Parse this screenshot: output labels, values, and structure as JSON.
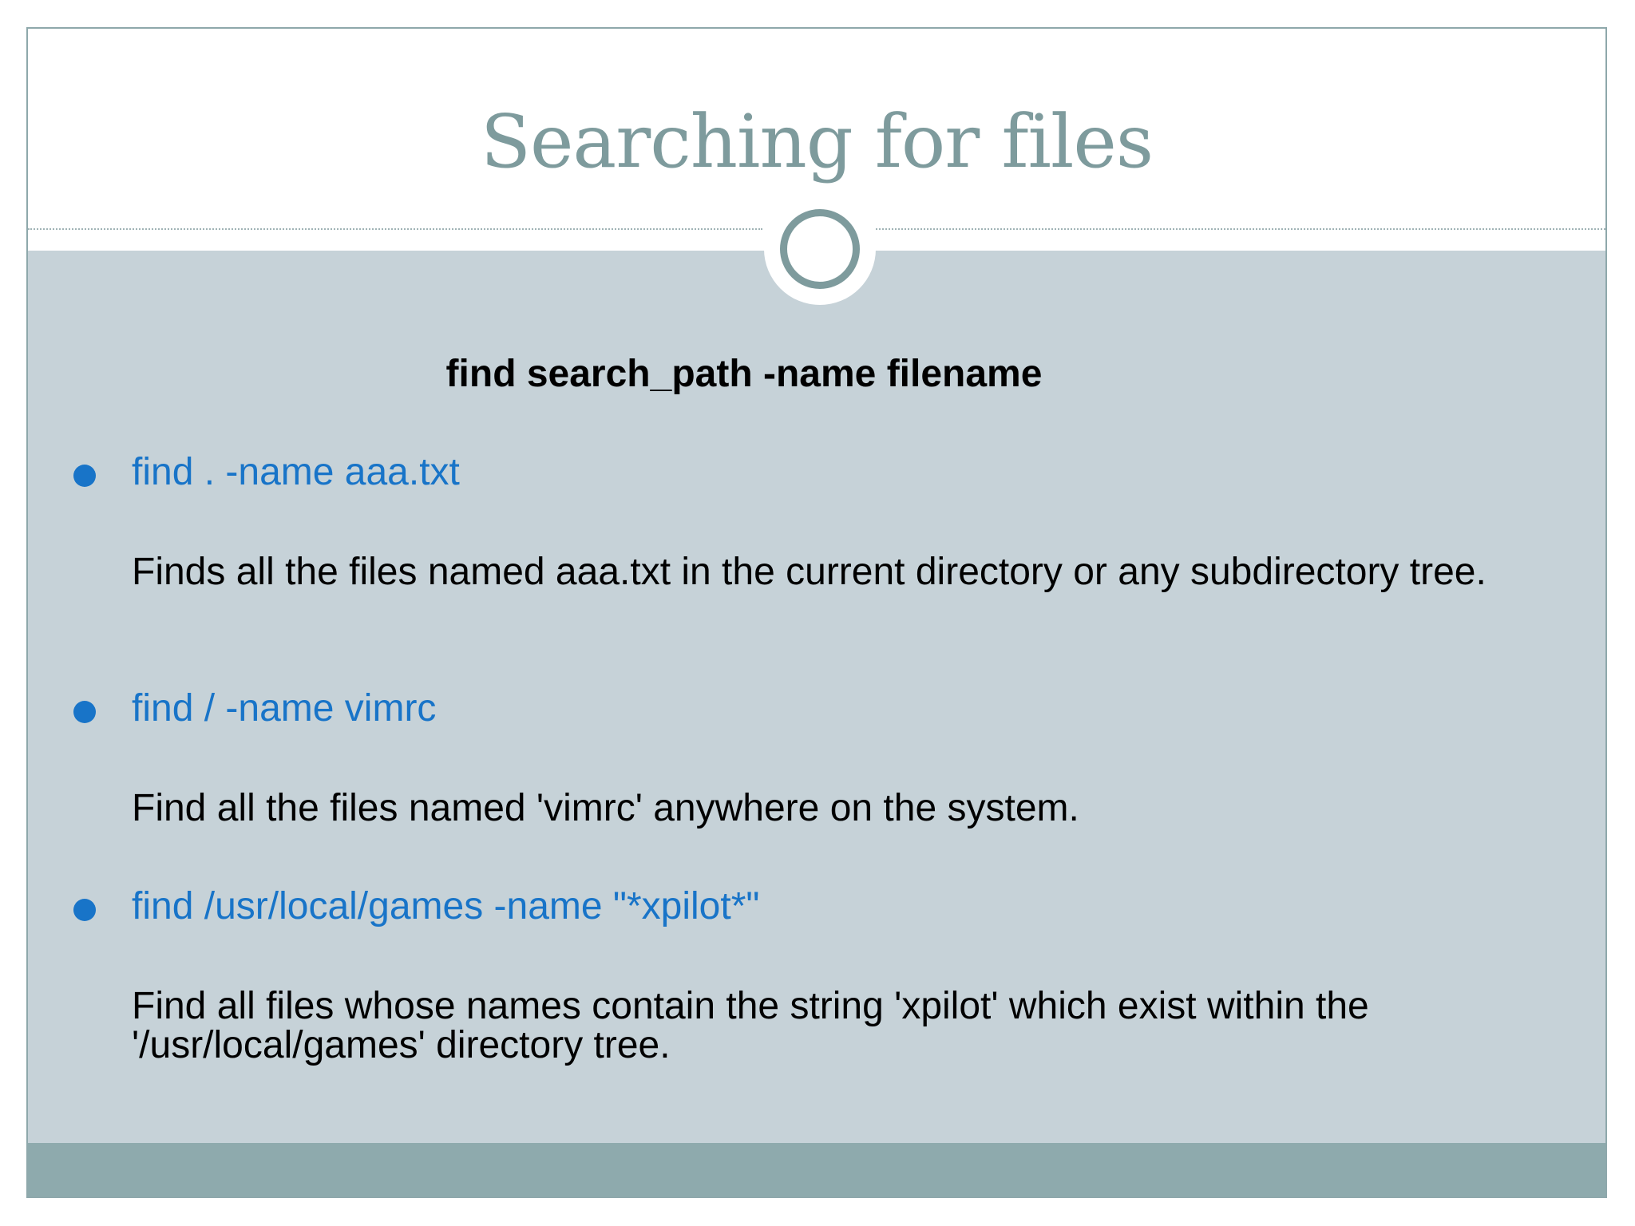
{
  "slide": {
    "title": "Searching for files",
    "syntax": "find search_path -name filename",
    "items": [
      {
        "command": "find . -name aaa.txt",
        "description": "Finds all the files named aaa.txt in the current directory or any subdirectory tree."
      },
      {
        "command": "find / -name vimrc",
        "description": "Find all the files named 'vimrc' anywhere on the system."
      },
      {
        "command": "find /usr/local/games -name \"*xpilot*\"",
        "description": "Find all files whose names contain the string 'xpilot' which exist within the '/usr/local/games' directory tree."
      }
    ]
  },
  "colors": {
    "title": "#7e9b9d",
    "content_background": "#c6d2d8",
    "footer_band": "#8eaaad",
    "command_text": "#1874c8",
    "bullet": "#1874c8"
  }
}
